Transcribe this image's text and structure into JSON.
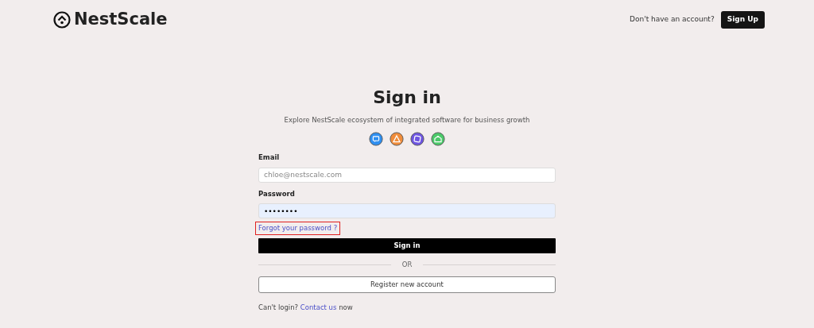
{
  "header": {
    "brand": "NestScale",
    "prompt": "Don't have an account?",
    "signup_button": "Sign Up"
  },
  "title": "Sign in",
  "subtitle": "Explore NestScale ecosystem of integrated software for business growth",
  "apps": [
    {
      "color": "#2f8ff0"
    },
    {
      "color": "#f08c3a"
    },
    {
      "color": "#6e55e0"
    },
    {
      "color": "#4cc96a"
    }
  ],
  "email": {
    "label": "Email",
    "placeholder": "chloe@nestscale.com"
  },
  "password": {
    "label": "Password",
    "value": "••••••••",
    "autofilled": true
  },
  "forgot_link": {
    "text": "Forgot your password ?",
    "highlighted": true
  },
  "sign_in_button": "Sign in",
  "divider": "OR",
  "register_button": "Register new account",
  "footer": {
    "before": "Can't login?",
    "link": "Contact us",
    "after": "now"
  }
}
